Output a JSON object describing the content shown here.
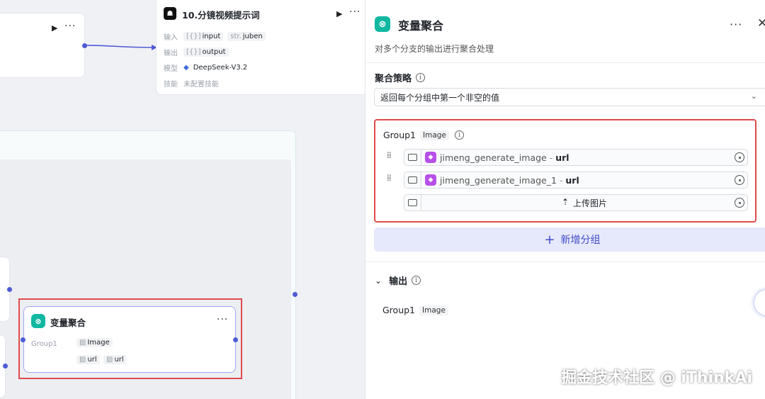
{
  "canvas": {
    "top_left_node": {
      "play_icon": "play-icon",
      "more_icon": "more-icon"
    },
    "storyboard_node": {
      "title": "10.分镜视频提示词",
      "input_label": "输入",
      "input_items": [
        {
          "prefix": "[{}]",
          "name": "input"
        },
        {
          "prefix": "str.",
          "name": "juben"
        }
      ],
      "output_label": "输出",
      "output_items": [
        {
          "prefix": "[{}]",
          "name": "output"
        }
      ],
      "model_label": "模型",
      "model_value": "DeepSeek-V3.2",
      "skill_label": "技能",
      "skill_value": "未配置技能"
    },
    "aggregator_node": {
      "title": "变量聚合",
      "group_label": "Group1",
      "group_type": "Image",
      "vars": [
        "url",
        "url"
      ]
    },
    "highlight_color": "#e04b4b",
    "edge_color": "#4e5bd6"
  },
  "panel": {
    "title": "变量聚合",
    "description": "对多个分支的输出进行聚合处理",
    "strategy": {
      "label": "聚合策略",
      "selected": "返回每个分组中第一个非空的值"
    },
    "group": {
      "name": "Group1",
      "type": "Image",
      "rows": [
        {
          "source": "jimeng_generate_image",
          "sep": " - ",
          "field": "url"
        },
        {
          "source": "jimeng_generate_image_1",
          "sep": " - ",
          "field": "url"
        }
      ],
      "upload_label": "上传图片"
    },
    "add_group_label": "新增分组",
    "output": {
      "label": "输出",
      "items": [
        {
          "name": "Group1",
          "type": "Image"
        }
      ]
    }
  },
  "watermark": "掘金技术社区 @ iThinkAi"
}
